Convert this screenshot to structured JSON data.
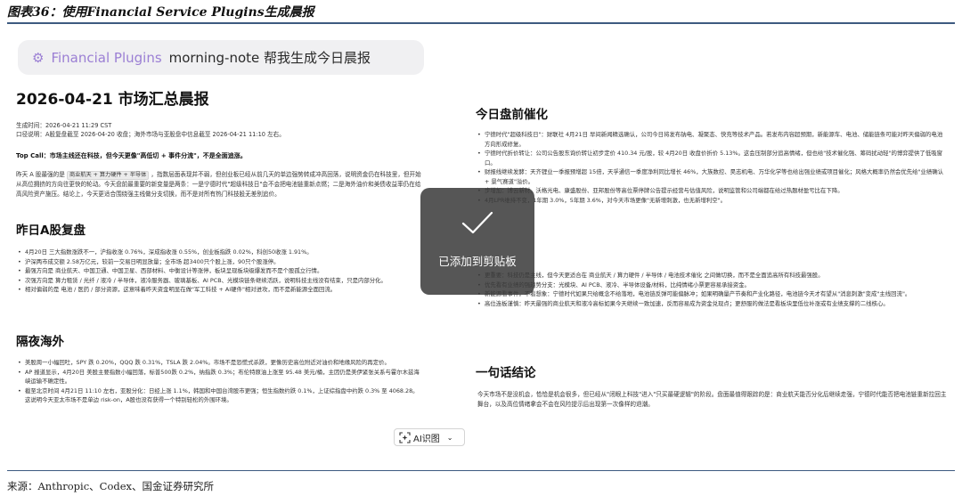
{
  "figure": {
    "caption": "图表36：使用Financial Service Plugins生成晨报",
    "source": "来源：Anthropic、Codex、国金证券研究所"
  },
  "prompt": {
    "plugin_label": "Financial Plugins",
    "command": "morning-note 帮我生成今日晨报"
  },
  "report": {
    "title": "2026-04-21 市场汇总晨报",
    "meta_time": "生成时间：2026-04-21 11:29 CST",
    "meta_scope": "口径说明：A股复盘截至 2026-04-20 收盘；海外市场与亚股盘中信息截至 2026-04-21 11:10 左右。",
    "top_call": "Top Call：市场主线还在科技，但今天更像\"高低切 + 事件分流\"，不是全面追涨。",
    "intro_p1": "昨天 A 股最强的是",
    "intro_tag": "商业航天 + 算力硬件 + 半导体",
    "intro_p2": "，指数层面表现并不弱，但创业板已经从前几天的单边强势转成冲高回落，说明资金仍在科技里，但开始从高位拥挤的方向往更快的轮动。今天盘前最重要的新变量是两条：一是宁德时代\"超级科技日\"会不会把电池链重新点燃；二是海外油价和美债收益率仍在给高风险资产施压。结论上，今天更适合围绕强主线做分支切换，而不是对所有热门科技股无差别追价。",
    "sections": {
      "yesterday": {
        "title": "昨日A股复盘",
        "items": [
          "4月20日 三大指数涨跌不一，沪指收涨 0.76%，深成指收涨 0.55%，创业板指跌 0.02%，科创50收涨 1.91%。",
          "沪深两市成交额 2.58万亿元，较前一交易日明显放量；全市场 超3400只个股上涨，90只个股涨停。",
          "最强方向是 商业航天、中国卫通、中国卫星、西部材料、中衡设计等涨停，板块呈现板块级爆发而不是个股孤立行情。",
          "次强方向是 算力租赁 / 光纤 / 液冷 / 半导体，液冷服务器、玻璃基板、AI PCB、光模块链条继续活跃，说明科技主线没有结束，只是内部分化。",
          "相对偏弱的是 电池 / 医药 / 部分资源，这意味着昨天资金明显在做\"军工科技 + AI硬件\"相对进攻，而不是新能源全面回流。"
        ]
      },
      "overnight": {
        "title": "隔夜海外",
        "items": [
          "美股周一小幅回吐，SPY 跌 0.20%，QQQ 跌 0.31%，TSLA 跌 2.04%。市场不是恐慌式杀跌，更像历史高位附近对油价和地缘风险的再定价。",
          "AP 报道显示，4月20日 美股主要指数小幅回落，标普500跌 0.2%，纳指跌 0.3%；布伦特原油上涨至 95.48 美元/桶，主因仍是美伊紧张关系与霍尔木兹海峡运输不确定性。",
          "截至北京时间 4月21日 11:10 左右，亚股分化：日经上涨 1.1%，韩国和中国台湾股市更强；恒生指数约跌 0.1%，上证综指盘中约跌 0.3% 至 4068.28。这说明今天亚太市场不是单边 risk-on，A股也没有获得一个特别轻松的外围环境。"
        ]
      },
      "premarket": {
        "title": "今日盘前催化",
        "items": [
          "宁德时代\"超级科技日\"：财联社 4月21日 早间新闻精选确认，公司今日将发布钠电、凝聚态、快充等技术产品。若发布内容超预期，新能源车、电池、储能链条可能对昨天偏弱的电池方向形成修复。",
          "宁德时代折价转让：公司公告股东询价转让初步定价 410.34 元/股，较 4月20日 收盘价折价 5.13%。这会压制部分追高情绪，但也给\"技术催化强、筹码扰动轻\"的博弈提供了低吸窗口。",
          "财报线继续发酵：天齐锂业一季报预增超 15倍，天孚通信一季度净利同比增长 46%，大族数控、昊志机电、万华化学等也给出强业绩或项目催化；风格大概率仍然会优先给\"业绩确认 + 景气赛道\"溢价。",
          "步增加：博云新材、沃格光电、康盛股份、亚邦股份等高位票停牌公告提示经营与估值风险，说明监管和公司端都在给过热题材盈亏比在下降。",
          "4月LPR维持不变，1年期 3.0%，5年期 3.6%，对今天市场更像\"无新增刺激，也无新增利空\"。"
        ]
      },
      "strategy": {
        "items": [
          "更重要：科技仍是主线，但今天更适合在 商业航天 / 算力硬件 / 半导体 / 电池技术催化 之间做切换，而不是全面追高所有科技最强股。",
          "优先看有业绩的强趋势分支：光模块、AI PCB、液冷、半导体设备/材料，比纯情绪小票更容易承接资金。",
          "新能源看事件，不看想象：宁德时代如果只给概念不给落地，电池链反弹可能偏脉冲；如果明确量产节奏和产业化路径，电池链今天才有望从\"消息刺激\"变成\"主线回流\"。",
          "高位连板谨慎：昨天最强的商业航天和液冷高标如果今天继续一致加速，反而容易成为资金兑现点；更舒服的做法是看板块里低位补涨或有业绩支撑的二线核心。"
        ]
      },
      "conclusion": {
        "title": "一句话结论",
        "text": "今天市场不是没机会，恰恰是机会很多，但已经从\"闭眼上科技\"进入\"只买最硬逻辑\"的阶段。盘面最值得跟踪的是：商业航天能否分化后继续走强，宁德时代能否把电池链重新拉回主舞台，以及高位情绪拿会不会在风险提示后出现第一次像样的退潮。"
      }
    }
  },
  "toast": {
    "text": "已添加到剪贴板",
    "icon": "check-icon"
  },
  "ai_button": {
    "label": "AI识图",
    "icon": "ai-scan-icon"
  }
}
